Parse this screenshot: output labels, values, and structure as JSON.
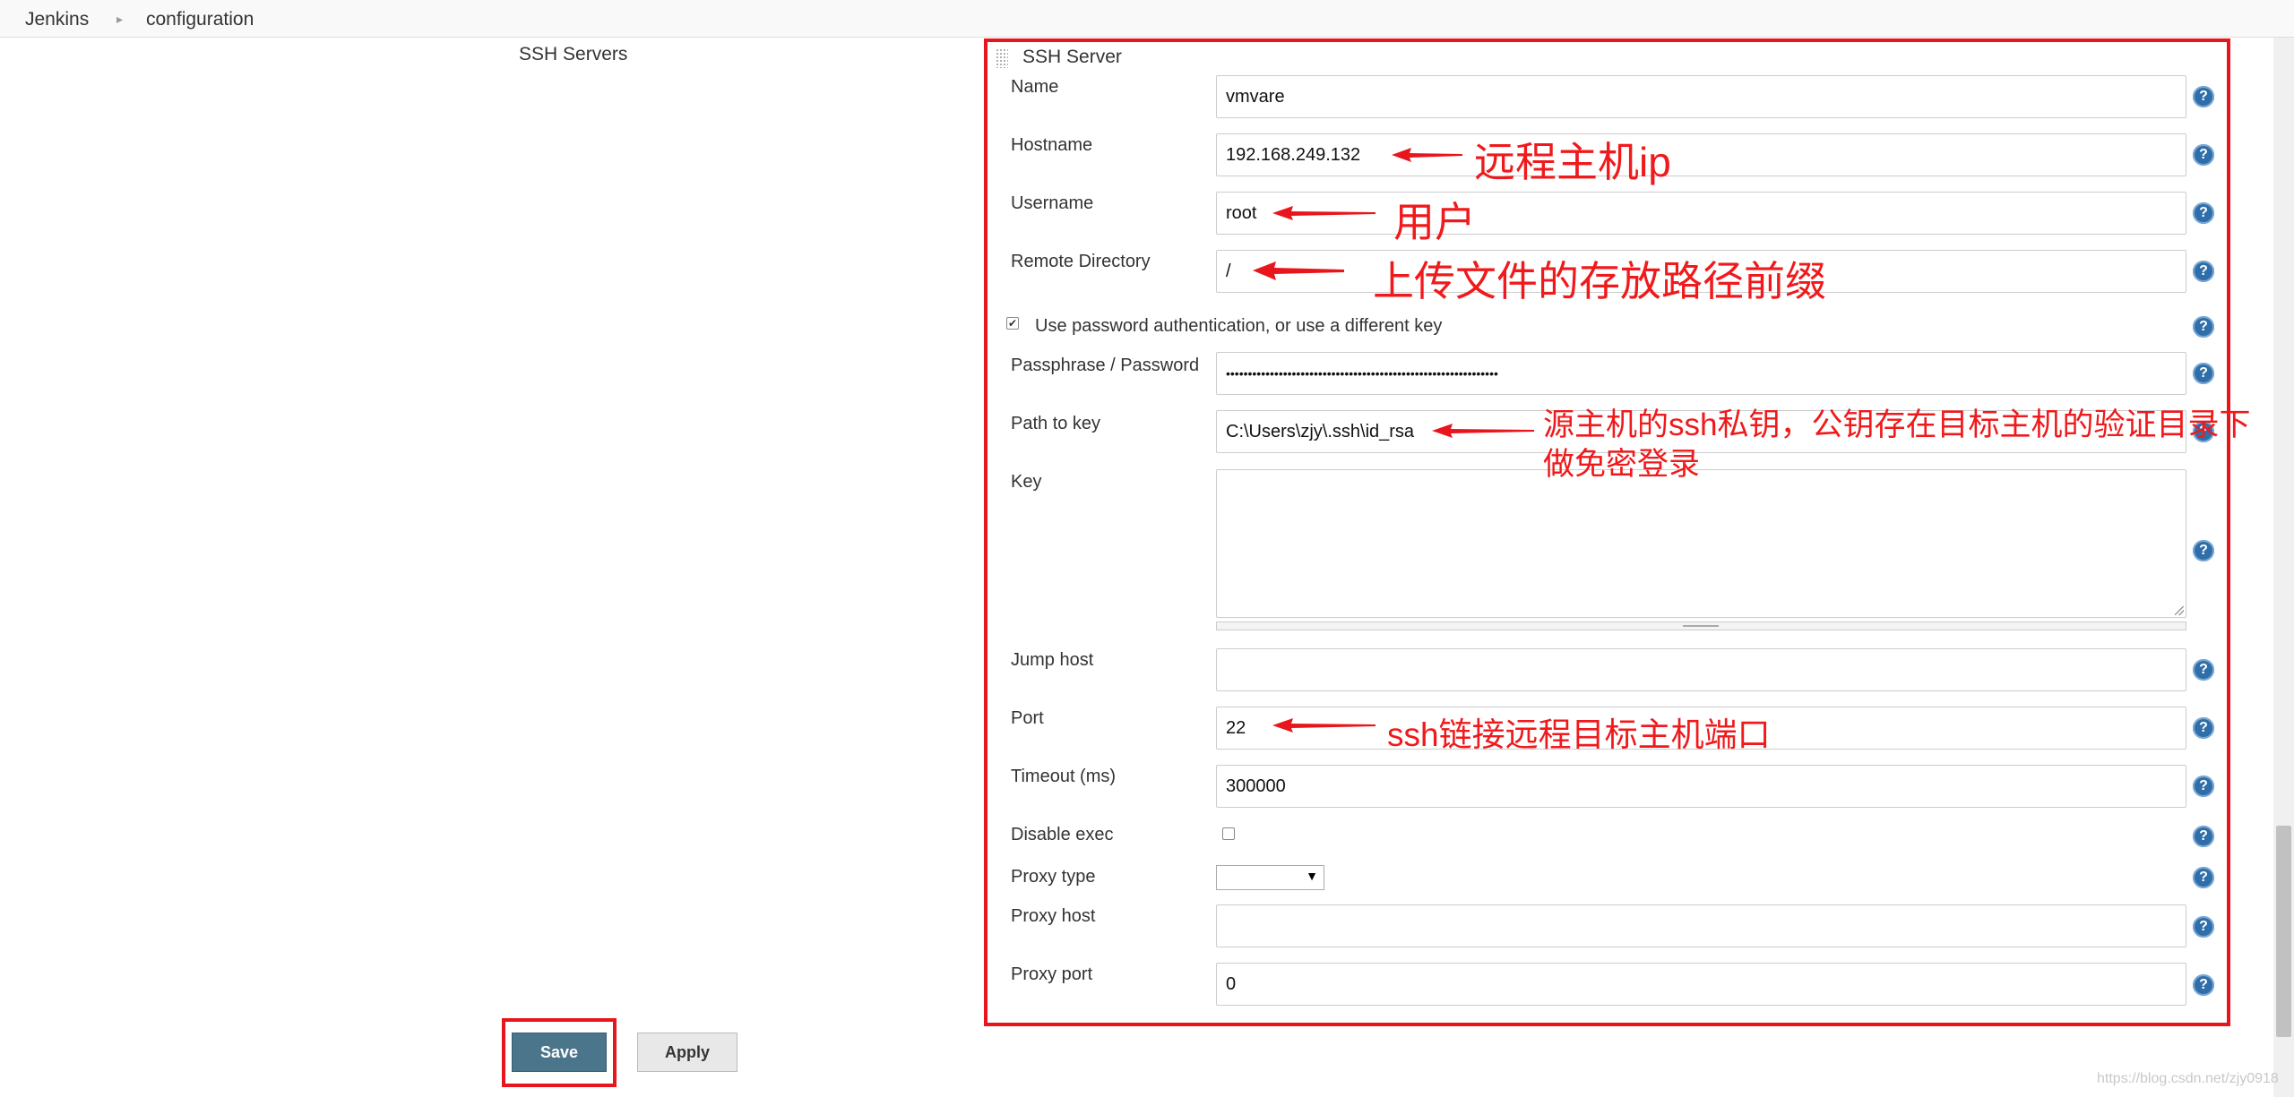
{
  "breadcrumb": {
    "items": [
      "Jenkins",
      "configuration"
    ]
  },
  "section": {
    "title": "SSH Servers"
  },
  "server": {
    "title": "SSH Server",
    "fields": {
      "name": {
        "label": "Name",
        "value": "vmvare"
      },
      "hostname": {
        "label": "Hostname",
        "value": "192.168.249.132"
      },
      "username": {
        "label": "Username",
        "value": "root"
      },
      "remote_directory": {
        "label": "Remote Directory",
        "value": "/"
      },
      "use_password": {
        "label": "Use password authentication, or use a different key",
        "checked": true
      },
      "passphrase": {
        "label": "Passphrase / Password",
        "value": "••••••••••••••••••••••••••••••••••••••••••••••••••••••••••••••"
      },
      "path_to_key": {
        "label": "Path to key",
        "value": "C:\\Users\\zjy\\.ssh\\id_rsa"
      },
      "key": {
        "label": "Key",
        "value": ""
      },
      "jump_host": {
        "label": "Jump host",
        "value": ""
      },
      "port": {
        "label": "Port",
        "value": "22"
      },
      "timeout": {
        "label": "Timeout (ms)",
        "value": "300000"
      },
      "disable_exec": {
        "label": "Disable exec",
        "checked": false
      },
      "proxy_type": {
        "label": "Proxy type",
        "value": ""
      },
      "proxy_host": {
        "label": "Proxy host",
        "value": ""
      },
      "proxy_port": {
        "label": "Proxy port",
        "value": "0"
      }
    },
    "help_icon": "?"
  },
  "annotations": {
    "hostname": "远程主机ip",
    "username": "用户",
    "remote_directory": "上传文件的存放路径前缀",
    "path_to_key_line1": "源主机的ssh私钥，公钥存在目标主机的验证目录下",
    "path_to_key_line2": "做免密登录",
    "port": "ssh链接远程目标主机端口",
    "color": "#f0191b"
  },
  "buttons": {
    "save": "Save",
    "apply": "Apply"
  },
  "watermark": "https://blog.csdn.net/zjy0918",
  "colors": {
    "annotation_red": "#e8161c",
    "save_button": "#4b758b",
    "help_icon": "#2f6ea8"
  },
  "icons": {
    "help": "help-icon",
    "drag": "drag-handle-icon",
    "dropdown": "chevron-down-icon"
  }
}
